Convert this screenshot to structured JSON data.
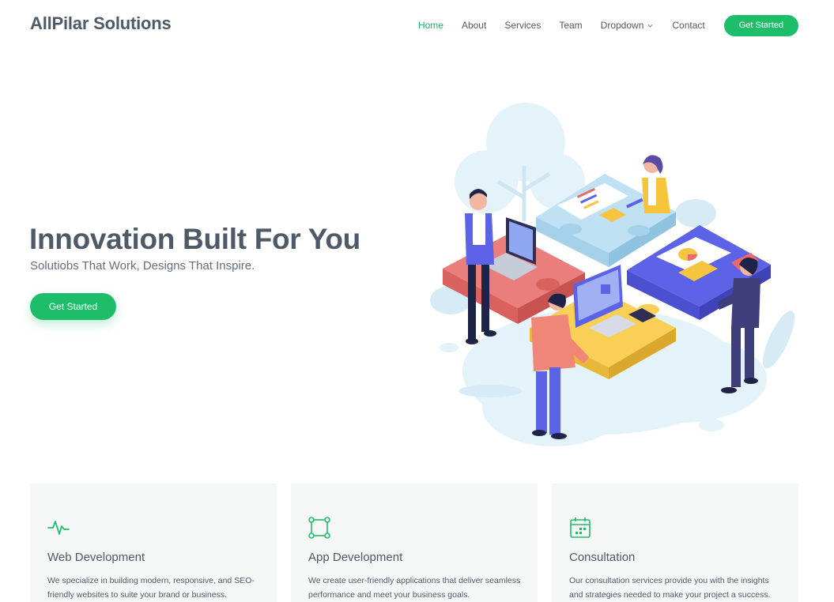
{
  "header": {
    "logo": "AllPilar Solutions",
    "nav": [
      {
        "label": "Home",
        "active": true
      },
      {
        "label": "About",
        "active": false
      },
      {
        "label": "Services",
        "active": false
      },
      {
        "label": "Team",
        "active": false
      },
      {
        "label": "Dropdown",
        "active": false
      },
      {
        "label": "Contact",
        "active": false
      }
    ],
    "cta": "Get Started"
  },
  "hero": {
    "title": "Innovation Built For You",
    "subtitle": "Solutiobs That Work, Designs That Inspire.",
    "cta": "Get Started"
  },
  "services": [
    {
      "icon": "activity-icon",
      "title": "Web Development",
      "text": "We specialize in building modern, responsive, and SEO-friendly websites to suite your brand or business."
    },
    {
      "icon": "bounding-box-icon",
      "title": "App Development",
      "text": "We create user-friendly applications that deliver seamless performance and meet your business goals."
    },
    {
      "icon": "calendar-icon",
      "title": "Consultation",
      "text": "Our consultation services provide you with the insights and strategies needed to make your project a success."
    }
  ],
  "colors": {
    "accent": "#1ebd69",
    "text": "#4f5a68",
    "card_bg": "#f6f7f7"
  }
}
